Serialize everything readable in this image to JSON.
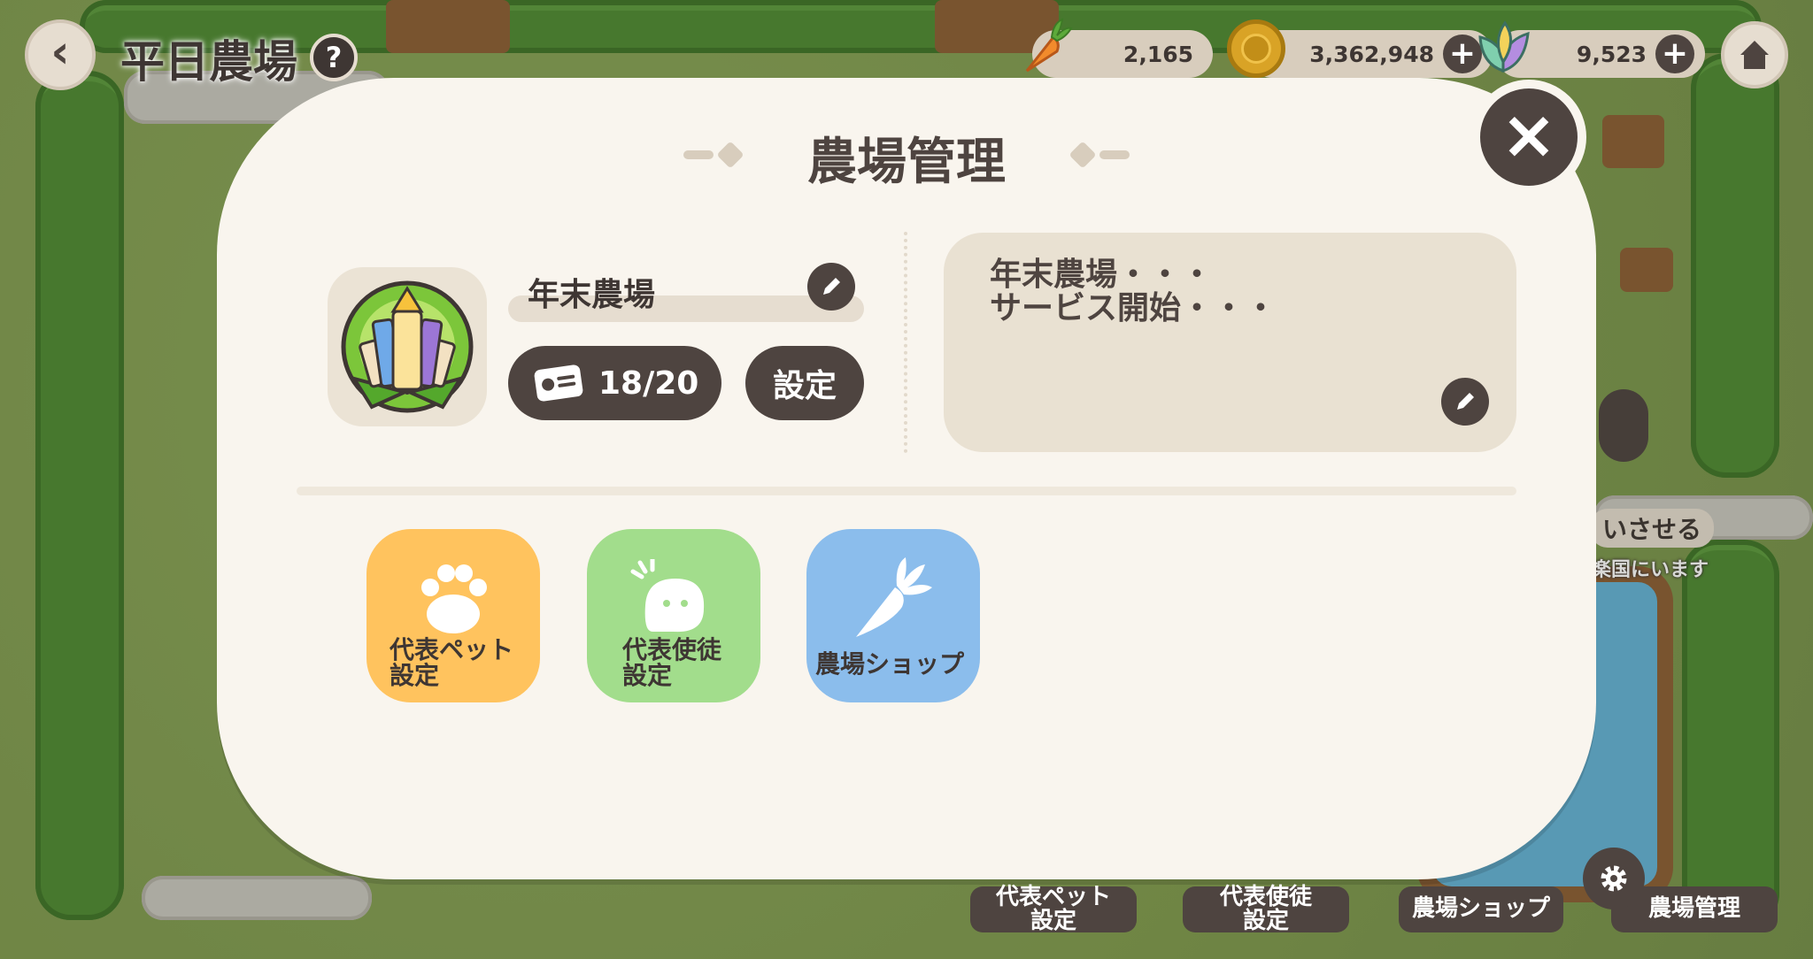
{
  "header": {
    "farm_name": "平日農場",
    "help_label": "?",
    "back_label": "‹"
  },
  "currencies": [
    {
      "name": "carrot",
      "icon": "carrot-icon",
      "value": "2,165",
      "has_plus": false
    },
    {
      "name": "coin",
      "icon": "coin-icon",
      "value": "3,362,948",
      "has_plus": true
    },
    {
      "name": "leaf",
      "icon": "leaf-icon",
      "value": "9,523",
      "has_plus": true
    }
  ],
  "currency_plus_label": "+",
  "modal": {
    "title": "農場管理",
    "close_label": "×",
    "farm_name_value": "年末農場",
    "member_count": "18/20",
    "settings_label": "設定",
    "description": "年末農場・・・\nサービス開始・・・",
    "features": [
      {
        "label": "代表ペット\n設定",
        "color": "#ffc35e",
        "icon": "paw-icon"
      },
      {
        "label": "代表使徒\n設定",
        "color": "#a2dd8c",
        "icon": "blob-icon"
      },
      {
        "label": "農場ショップ",
        "color": "#8bbdec",
        "icon": "carrot-icon"
      }
    ]
  },
  "bottom_bar": {
    "pet_label": "代表ペット\n設定",
    "apostle_label": "代表使徒\n設定",
    "shop_label": "農場ショップ",
    "manage_label": "農場管理"
  },
  "background_fragments": {
    "partial_text_1": "いさせる",
    "partial_text_2": "楽国にいます"
  },
  "colors": {
    "modal_bg": "#f9f5ee",
    "dark": "#4e4440",
    "panel": "#e9e1d2",
    "pet_yellow": "#ffc35e",
    "apostle_green": "#a2dd8c",
    "shop_blue": "#8bbdec"
  }
}
